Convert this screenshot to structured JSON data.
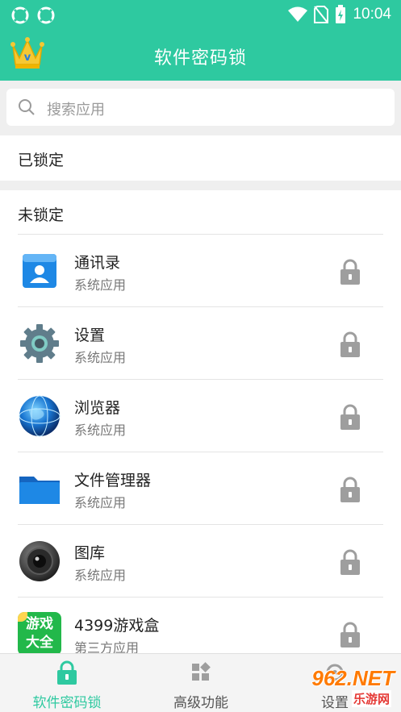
{
  "status_bar": {
    "time": "10:04"
  },
  "app_bar": {
    "title": "软件密码锁"
  },
  "search": {
    "placeholder": "搜索应用"
  },
  "sections": {
    "locked_title": "已锁定",
    "unlocked_title": "未锁定"
  },
  "apps": [
    {
      "name": "通讯录",
      "type": "系统应用",
      "icon": "contacts-icon"
    },
    {
      "name": "设置",
      "type": "系统应用",
      "icon": "settings-gear-icon"
    },
    {
      "name": "浏览器",
      "type": "系统应用",
      "icon": "browser-globe-icon"
    },
    {
      "name": "文件管理器",
      "type": "系统应用",
      "icon": "folder-icon"
    },
    {
      "name": "图库",
      "type": "系统应用",
      "icon": "gallery-camera-icon"
    },
    {
      "name": "4399游戏盒",
      "type": "第三方应用",
      "icon": "game-box-icon",
      "icon_text_top": "游戏",
      "icon_text_bottom": "大全"
    }
  ],
  "bottom_nav": [
    {
      "label": "软件密码锁",
      "icon": "lock-icon",
      "active": true
    },
    {
      "label": "高级功能",
      "icon": "grid-icon",
      "active": false
    },
    {
      "label": "设置",
      "icon": "gear-icon",
      "active": false
    }
  ],
  "watermark": {
    "text_top": "962.NET",
    "text_bottom": "乐游网"
  },
  "colors": {
    "primary": "#2ec9a0",
    "lock_gray": "#9e9e9e",
    "nav_bg": "#f4f4f4"
  }
}
